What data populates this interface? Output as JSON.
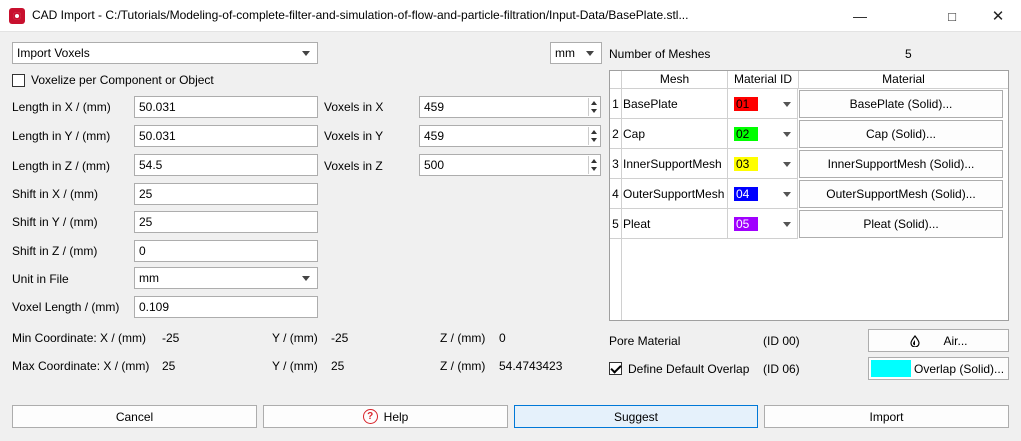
{
  "window": {
    "title": "CAD Import - C:/Tutorials/Modeling-of-complete-filter-and-simulation-of-flow-and-particle-filtration/Input-Data/BasePlate.stl..."
  },
  "left": {
    "mode_select": "Import Voxels",
    "voxelize_label": "Voxelize per Component or Object",
    "fields": [
      {
        "label": "Length in X / (mm)",
        "value": "50.031"
      },
      {
        "label": "Length in Y / (mm)",
        "value": "50.031"
      },
      {
        "label": "Length in Z / (mm)",
        "value": "54.5"
      },
      {
        "label": "Shift  in X / (mm)",
        "value": "25"
      },
      {
        "label": "Shift  in Y / (mm)",
        "value": "25"
      },
      {
        "label": "Shift  in Z / (mm)",
        "value": "0"
      }
    ],
    "voxels": [
      {
        "label": "Voxels in X",
        "value": "459"
      },
      {
        "label": "Voxels in Y",
        "value": "459"
      },
      {
        "label": "Voxels in Z",
        "value": "500"
      }
    ],
    "unit_label": "Unit in File",
    "unit_value": "mm",
    "voxel_length_label": "Voxel Length / (mm)",
    "voxel_length_value": "0.109",
    "min": {
      "label": "Min Coordinate: X / (mm)",
      "x": "-25",
      "y_label": "Y / (mm)",
      "y": "-25",
      "z_label": "Z / (mm)",
      "z": "0"
    },
    "max": {
      "label": "Max Coordinate: X / (mm)",
      "x": "25",
      "y_label": "Y / (mm)",
      "y": "25",
      "z_label": "Z / (mm)",
      "z": "54.4743423"
    }
  },
  "units_select": "mm",
  "meshes": {
    "count_label": "Number of Meshes",
    "count": "5",
    "headers": [
      "Mesh",
      "Material ID",
      "Material"
    ],
    "rows": [
      {
        "n": "1",
        "mesh": "BasePlate",
        "id": "01",
        "color": "#ff0000",
        "material": "BasePlate (Solid)..."
      },
      {
        "n": "2",
        "mesh": "Cap",
        "id": "02",
        "color": "#00ff00",
        "material": "Cap (Solid)..."
      },
      {
        "n": "3",
        "mesh": "InnerSupportMesh",
        "id": "03",
        "color": "#ffff00",
        "material": "InnerSupportMesh (Solid)..."
      },
      {
        "n": "4",
        "mesh": "OuterSupportMesh",
        "id": "04",
        "color": "#0000ff",
        "material": "OuterSupportMesh (Solid)..."
      },
      {
        "n": "5",
        "mesh": "Pleat",
        "id": "05",
        "color": "#a000ff",
        "material": "Pleat (Solid)..."
      }
    ]
  },
  "pore": {
    "label": "Pore Material",
    "id": "(ID 00)",
    "button": "Air..."
  },
  "overlap": {
    "label": "Define Default Overlap",
    "id": "(ID 06)",
    "button": "Overlap (Solid)...",
    "color": "#00ffff"
  },
  "buttons": {
    "cancel": "Cancel",
    "help": "Help",
    "suggest": "Suggest",
    "import": "Import"
  }
}
